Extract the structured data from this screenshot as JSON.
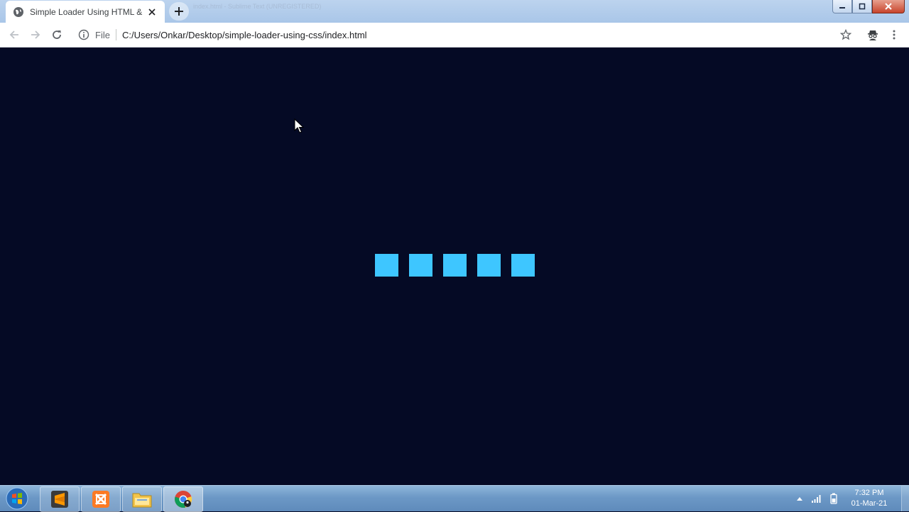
{
  "browser": {
    "tab": {
      "title": "Simple Loader Using HTML & CSS",
      "favicon": "globe-icon",
      "close_icon": "close-icon"
    },
    "new_tab_icon": "plus-icon",
    "background_window_title": "index.html - Sublime Text (UNREGISTERED)",
    "window_controls": [
      "minimize-icon",
      "maximize-icon",
      "close-icon"
    ],
    "toolbar": {
      "back_icon": "arrow-left-icon",
      "forward_icon": "arrow-right-icon",
      "reload_icon": "reload-icon",
      "site_info_icon": "info-icon",
      "scheme_label": "File",
      "url": "C:/Users/Onkar/Desktop/simple-loader-using-css/index.html",
      "bookmark_icon": "star-icon",
      "profile_icon": "incognito-icon",
      "menu_icon": "kebab-menu-icon"
    }
  },
  "page": {
    "background_color": "#050a25",
    "loader": {
      "square_count": 5,
      "square_color": "#3ec6ff"
    }
  },
  "taskbar": {
    "start_icon": "windows-start-icon",
    "apps": [
      {
        "name": "sublime-text-icon",
        "active": false
      },
      {
        "name": "xampp-icon",
        "active": false
      },
      {
        "name": "file-explorer-icon",
        "active": false
      },
      {
        "name": "chrome-icon",
        "active": true
      }
    ],
    "tray": {
      "overflow_icon": "chevron-up-icon",
      "network_icon": "signal-icon",
      "battery_icon": "battery-icon"
    },
    "clock": {
      "time": "7:32 PM",
      "date": "01-Mar-21"
    }
  }
}
